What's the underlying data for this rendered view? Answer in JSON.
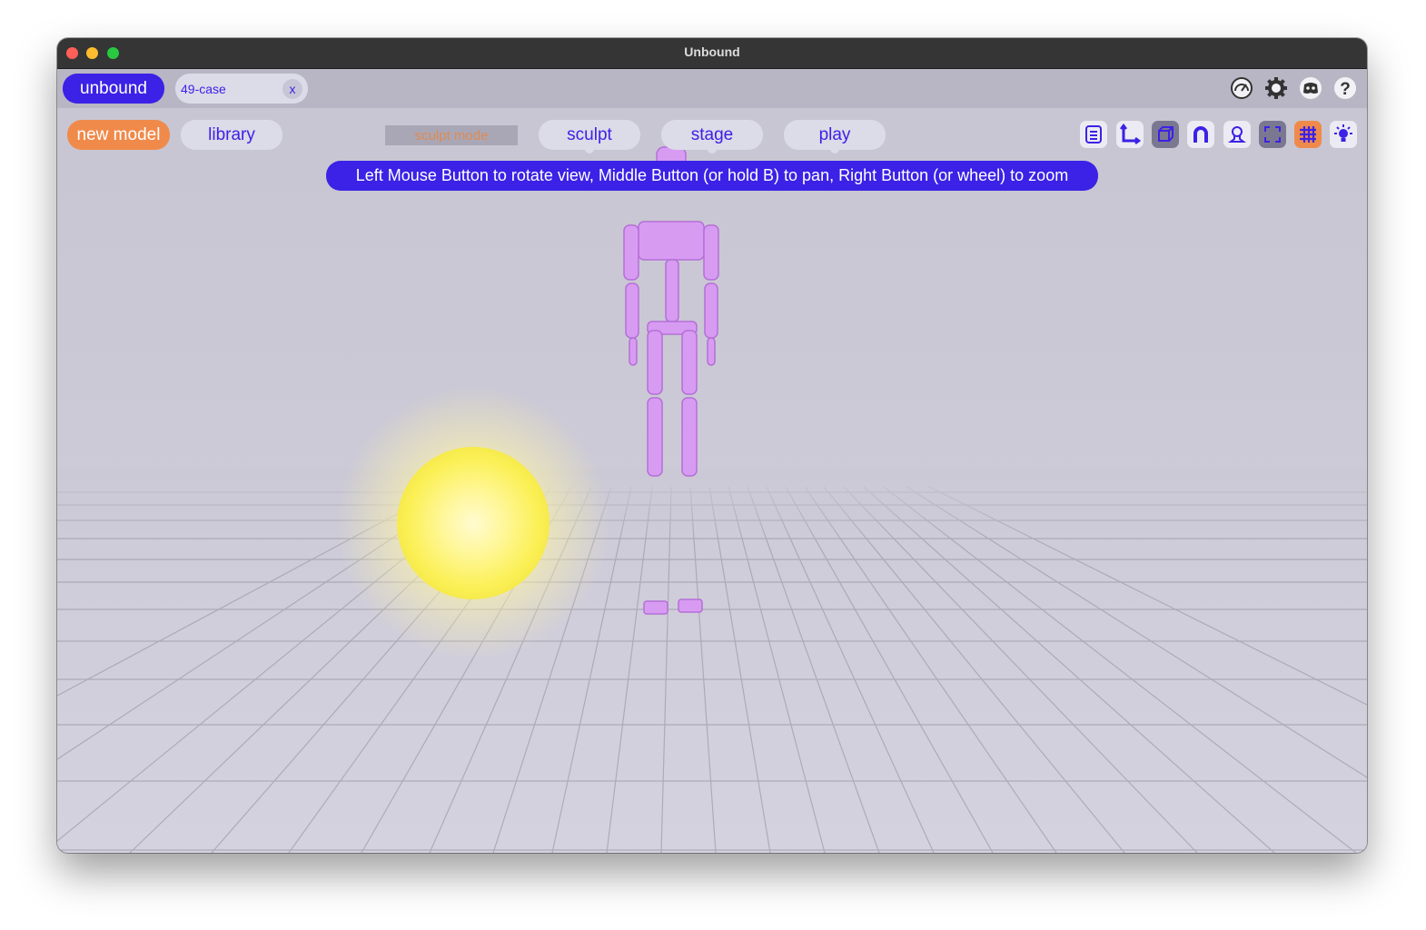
{
  "window": {
    "title": "Unbound"
  },
  "topbar": {
    "brand": "unbound",
    "case_tab": {
      "label": "49-case",
      "close": "x"
    },
    "icons": [
      "performance-gauge-icon",
      "gear-icon",
      "discord-icon",
      "help-icon"
    ],
    "help_glyph": "?"
  },
  "toolbar": {
    "new_model": "new model",
    "library": "library",
    "mode_label": "sculpt mode",
    "tabs": {
      "sculpt": "sculpt",
      "stage": "stage",
      "play": "play"
    },
    "tool_icons": [
      "list-icon",
      "axes-icon",
      "cube-icon",
      "magnet-icon",
      "person-icon",
      "frame-icon",
      "grid-icon",
      "light-icon"
    ]
  },
  "hint": "Left Mouse Button to rotate view, Middle Button (or hold B) to pan, Right Button (or wheel) to zoom",
  "colors": {
    "accent": "#3b22e6",
    "orange": "#f08a4b",
    "figure": "#d79cf2",
    "sun": "#fff46a"
  }
}
